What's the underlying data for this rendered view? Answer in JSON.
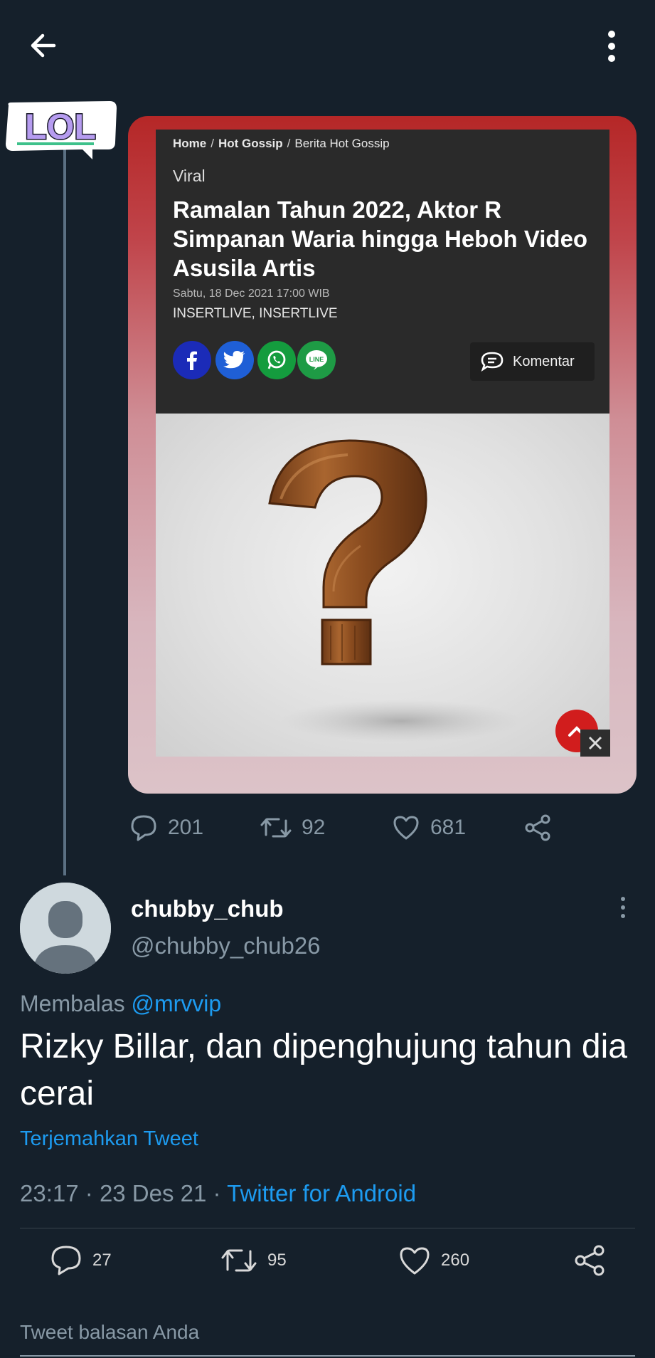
{
  "article": {
    "breadcrumb_home": "Home",
    "breadcrumb_sep": "/",
    "breadcrumb_category": "Hot Gossip",
    "breadcrumb_page": "Berita Hot Gossip",
    "tag": "Viral",
    "headline": "Ramalan Tahun 2022, Aktor R Simpanan Waria hingga Heboh Video Asusila Artis",
    "date": "Sabtu, 18 Dec 2021 17:00 WIB",
    "source": "INSERTLIVE, INSERTLIVE",
    "share_icons": [
      "facebook-icon",
      "twitter-icon",
      "whatsapp-icon",
      "line-icon"
    ],
    "line_label": "LINE",
    "comment_label": "Komentar",
    "image": "question-mark-image",
    "brand_red": "#d11d1d"
  },
  "parent_tweet": {
    "replies": "201",
    "retweets": "92",
    "likes": "681"
  },
  "sticker": {
    "text": "LOL"
  },
  "reply": {
    "display_name": "chubby_chub",
    "handle": "@chubby_chub26",
    "replying_prefix": "Membalas",
    "replying_to": "@mrvvip",
    "text": "Rizky Billar, dan dipenghujung tahun dia cerai",
    "translate": "Terjemahkan Tweet",
    "time": "23:17",
    "date": "23 Des 21",
    "separator": "·",
    "client": "Twitter for Android",
    "replies": "27",
    "retweets": "95",
    "likes": "260"
  },
  "composer": {
    "placeholder": "Tweet balasan Anda"
  },
  "colors": {
    "background": "#15202b",
    "accent": "#1d9bf0",
    "muted": "#8899a6"
  }
}
